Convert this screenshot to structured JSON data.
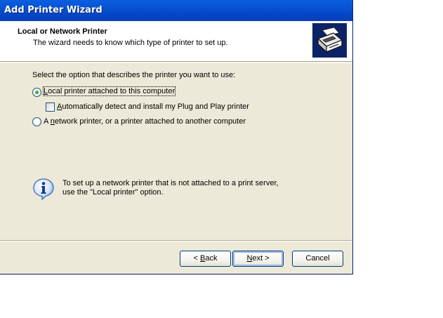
{
  "window": {
    "title": "Add Printer Wizard"
  },
  "header": {
    "title": "Local or Network Printer",
    "subtitle": "The wizard needs to know which type of printer to set up.",
    "icon": "printer-icon"
  },
  "body": {
    "prompt": "Select the option that describes the printer you want to use:",
    "options": [
      {
        "accel": "L",
        "rest": "ocal printer attached to this computer",
        "selected": true
      },
      {
        "pre": "A ",
        "accel": "n",
        "rest": "etwork printer, or a printer attached to another computer",
        "selected": false
      }
    ],
    "autodetect": {
      "accel": "A",
      "rest": "utomatically detect and install my Plug and Play printer",
      "checked": false
    },
    "info": {
      "icon": "info-icon",
      "line1": "To set up a network printer that is not attached to a print server,",
      "line2": "use the \"Local printer\" option."
    }
  },
  "buttons": {
    "back_pre": "< ",
    "back_accel": "B",
    "back_rest": "ack",
    "next_accel": "N",
    "next_rest": "ext >",
    "cancel": "Cancel"
  },
  "colors": {
    "titlebar": "#0A5FE0",
    "face": "#ECE9D8",
    "radio_dot": "#21A121"
  }
}
